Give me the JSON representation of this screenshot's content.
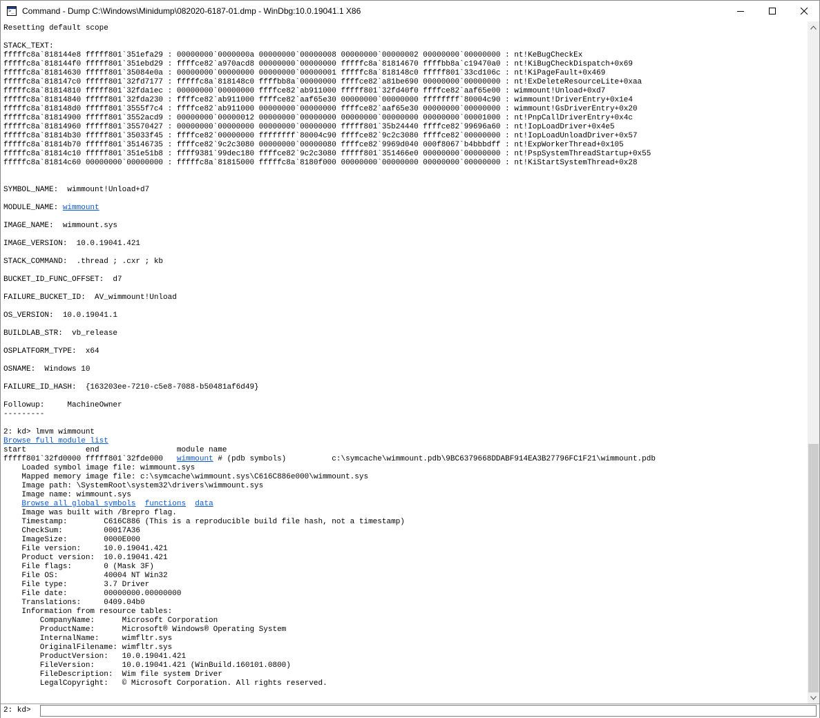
{
  "window": {
    "title": "Command - Dump C:\\Windows\\Minidump\\082020-6187-01.dmp - WinDbg:10.0.19041.1 X86",
    "app_icon": "console-icon",
    "controls": [
      "minimize-icon",
      "maximize-icon",
      "close-icon"
    ]
  },
  "output": {
    "reset_scope": "Resetting default scope",
    "stack_header": "STACK_TEXT:",
    "stack": [
      "fffffc8a`818144e8 fffff801`351efa29 : 00000000`0000000a 00000000`00000008 00000000`00000002 00000000`00000000 : nt!KeBugCheckEx",
      "fffffc8a`818144f0 fffff801`351ebd29 : ffffce82`a970acd8 00000000`00000000 fffffc8a`81814670 ffffbb8a`c19470a0 : nt!KiBugCheckDispatch+0x69",
      "fffffc8a`81814630 fffff801`35084e0a : 00000000`00000000 00000000`00000001 fffffc8a`818148c0 fffff801`33cd106c : nt!KiPageFault+0x469",
      "fffffc8a`818147c0 fffff801`32fd7177 : fffffc8a`818148c0 ffffbb8a`00000000 ffffce82`a81be690 00000000`00000000 : nt!ExDeleteResourceLite+0xaa",
      "fffffc8a`81814810 fffff801`32fda1ec : 00000000`00000000 ffffce82`ab911000 fffff801`32fd40f0 ffffce82`aaf65e00 : wimmount!Unload+0xd7",
      "fffffc8a`81814840 fffff801`32fda230 : ffffce82`ab911000 ffffce82`aaf65e30 00000000`00000000 ffffffff`80004c90 : wimmount!DriverEntry+0x1e4",
      "fffffc8a`818148d0 fffff801`3555f7c4 : ffffce82`ab911000 00000000`00000000 ffffce82`aaf65e30 00000000`00000000 : wimmount!GsDriverEntry+0x20",
      "fffffc8a`81814900 fffff801`3552acd9 : 00000000`00000012 00000000`00000000 00000000`00000000 00000000`00001000 : nt!PnpCallDriverEntry+0x4c",
      "fffffc8a`81814960 fffff801`35570427 : 00000000`00000000 00000000`00000000 fffff801`35b24440 ffffce82`99696a60 : nt!IopLoadDriver+0x4e5",
      "fffffc8a`81814b30 fffff801`35033f45 : ffffce82`00000000 ffffffff`80004c90 ffffce82`9c2c3080 ffffce82`00000000 : nt!IopLoadUnloadDriver+0x57",
      "fffffc8a`81814b70 fffff801`35146735 : ffffce82`9c2c3080 00000000`00000080 ffffce82`9969d040 000f8067`b4bbbdff : nt!ExpWorkerThread+0x105",
      "fffffc8a`81814c10 fffff801`351e51b8 : ffff9381`99dec180 ffffce82`9c2c3080 fffff801`351466e0 00000000`00000000 : nt!PspSystemThreadStartup+0x55",
      "fffffc8a`81814c60 00000000`00000000 : fffffc8a`81815000 fffffc8a`8180f000 00000000`00000000 00000000`00000000 : nt!KiStartSystemThread+0x28"
    ],
    "symbol_name": "SYMBOL_NAME:  wimmount!Unload+d7",
    "module_name_label": "MODULE_NAME: ",
    "module_name_link": "wimmount",
    "image_name": "IMAGE_NAME:  wimmount.sys",
    "image_version": "IMAGE_VERSION:  10.0.19041.421",
    "stack_command": "STACK_COMMAND:  .thread ; .cxr ; kb",
    "bucket_func_offset": "BUCKET_ID_FUNC_OFFSET:  d7",
    "failure_bucket": "FAILURE_BUCKET_ID:  AV_wimmount!Unload",
    "os_version": "OS_VERSION:  10.0.19041.1",
    "buildlab": "BUILDLAB_STR:  vb_release",
    "osplatform": "OSPLATFORM_TYPE:  x64",
    "osname": "OSNAME:  Windows 10",
    "failure_hash": "FAILURE_ID_HASH:  {163203ee-7210-c5e8-7088-b50481af6d49}",
    "followup": "Followup:     MachineOwner",
    "separator": "---------",
    "command_echo": "2: kd> lmvm wimmount",
    "browse_modules": "Browse full module list",
    "module_header": "start             end                 module name",
    "module_line_start": "fffff801`32fd0000 fffff801`32fde000   ",
    "module_line_link": "wimmount",
    "module_line_rest": " # (pdb symbols)          c:\\symcache\\wimmount.pdb\\9BC6379668DDABF914EA3B27796FC1F21\\wimmount.pdb",
    "loaded_symbol": "    Loaded symbol image file: wimmount.sys",
    "mapped_memory": "    Mapped memory image file: c:\\symcache\\wimmount.sys\\C616C886e000\\wimmount.sys",
    "image_path": "    Image path: \\SystemRoot\\system32\\drivers\\wimmount.sys",
    "image_name_line": "    Image name: wimmount.sys",
    "link_globals": "Browse all global symbols",
    "link_functions": "functions",
    "link_data": "data",
    "brepro": "    Image was built with /Brepro flag.",
    "timestamp": "    Timestamp:        C616C886 (This is a reproducible build file hash, not a timestamp)",
    "checksum": "    CheckSum:         00017A36",
    "imagesize": "    ImageSize:        0000E000",
    "file_version": "    File version:     10.0.19041.421",
    "product_version": "    Product version:  10.0.19041.421",
    "file_flags": "    File flags:       0 (Mask 3F)",
    "file_os": "    File OS:          40004 NT Win32",
    "file_type": "    File type:        3.7 Driver",
    "file_date": "    File date:        00000000.00000000",
    "translations": "    Translations:     0409.04b0",
    "info_header": "    Information from resource tables:",
    "company": "        CompanyName:      Microsoft Corporation",
    "product_name": "        ProductName:      Microsoft® Windows® Operating System",
    "internal_name": "        InternalName:     wimfltr.sys",
    "original_filename": "        OriginalFilename: wimfltr.sys",
    "product_version_res": "        ProductVersion:   10.0.19041.421",
    "file_version_res": "        FileVersion:      10.0.19041.421 (WinBuild.160101.0800)",
    "file_description": "        FileDescription:  Wim file system Driver",
    "legal_copyright": "        LegalCopyright:   © Microsoft Corporation. All rights reserved."
  },
  "command_bar": {
    "prompt": "2: kd>",
    "input_value": ""
  }
}
